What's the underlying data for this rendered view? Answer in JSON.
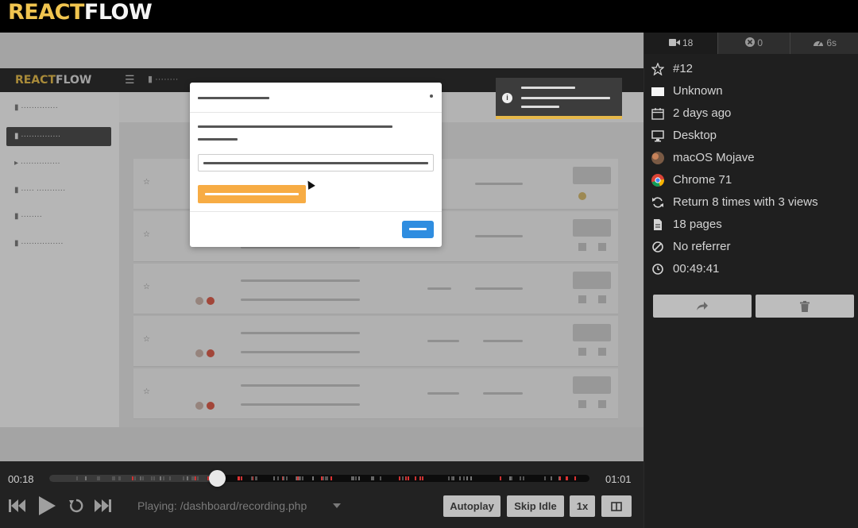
{
  "brand": {
    "logo_react": "REACT",
    "logo_flow": "FLOW"
  },
  "player": {
    "current_time": "00:18",
    "total_time": "01:01",
    "progress": 0.31,
    "playing_label": "Playing: /dashboard/recording.php",
    "buttons": {
      "autoplay": "Autoplay",
      "skip_idle": "Skip Idle",
      "speed": "1x"
    }
  },
  "replay": {
    "logo_react": "REACT",
    "logo_flow": "FLOW",
    "toast_icon": "i"
  },
  "tabs": [
    {
      "icon": "video-camera-icon",
      "label": "18"
    },
    {
      "icon": "error-circle-icon",
      "label": "0"
    },
    {
      "icon": "speedometer-icon",
      "label": "6s"
    }
  ],
  "details": {
    "id": "#12",
    "user": "Unknown",
    "date": "2 days ago",
    "device": "Desktop",
    "os": "macOS Mojave",
    "browser": "Chrome 71",
    "returns": "Return 8 times with 3 views",
    "pages": "18 pages",
    "referrer": "No referrer",
    "duration": "00:49:41"
  },
  "colors": {
    "accent": "#f0c44f",
    "panel_bg": "#1f1f1f",
    "ok_button": "#2f8de0",
    "warn_button": "#f7ac44"
  }
}
